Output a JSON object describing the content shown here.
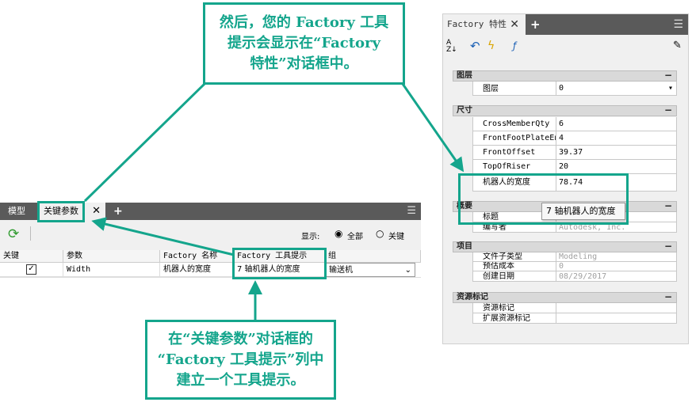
{
  "props_panel": {
    "tab_label": "Factory 特性",
    "sections": [
      {
        "title": "图层",
        "rows": [
          {
            "key": "图层",
            "value": "0"
          }
        ]
      },
      {
        "title": "尺寸",
        "rows": [
          {
            "key": "CrossMemberQty",
            "value": "6"
          },
          {
            "key": "FrontFootPlateEnd",
            "value": "4"
          },
          {
            "key": "FrontOffset",
            "value": "39.37"
          },
          {
            "key": "TopOfRiser",
            "value": "20"
          },
          {
            "key": "机器人的宽度",
            "value": "78.74"
          }
        ]
      },
      {
        "title": "概要",
        "rows": [
          {
            "key": "标题",
            "value": ""
          },
          {
            "key": "编写者",
            "value": "Autodesk, Inc."
          }
        ]
      },
      {
        "title": "项目",
        "rows": [
          {
            "key": "文件子类型",
            "value": "Modeling"
          },
          {
            "key": "预估成本",
            "value": "0"
          },
          {
            "key": "创建日期",
            "value": "08/29/2017"
          }
        ]
      },
      {
        "title": "资源标记",
        "rows": [
          {
            "key": "资源标记",
            "value": ""
          },
          {
            "key": "扩展资源标记",
            "value": ""
          }
        ]
      }
    ],
    "tooltip": "7 轴机器人的宽度"
  },
  "dialog": {
    "tab_model": "模型",
    "tab_params": "关键参数",
    "display_label": "显示:",
    "radio_all": "全部",
    "radio_key": "关键",
    "columns": [
      "关键",
      "参数",
      "Factory 名称",
      "Factory 工具提示",
      "组"
    ],
    "rows": [
      {
        "param": "Width",
        "name": "机器人的宽度",
        "tooltip": "7 轴机器人的宽度",
        "group": "输送机"
      }
    ]
  },
  "callouts": {
    "top": "然后，您的 Factory 工具提示会显示在“Factory 特性”对话框中。",
    "top_lines": [
      "然后，您的 Factory 工具",
      "提示会显示在“Factory",
      "特性”对话框中。"
    ],
    "bottom_lines": [
      "在“关键参数”对话框的",
      "“Factory 工具提示”列中",
      "建立一个工具提示。"
    ]
  },
  "colors": {
    "accent": "#14a58c",
    "tabbar": "#5a5a5a"
  }
}
